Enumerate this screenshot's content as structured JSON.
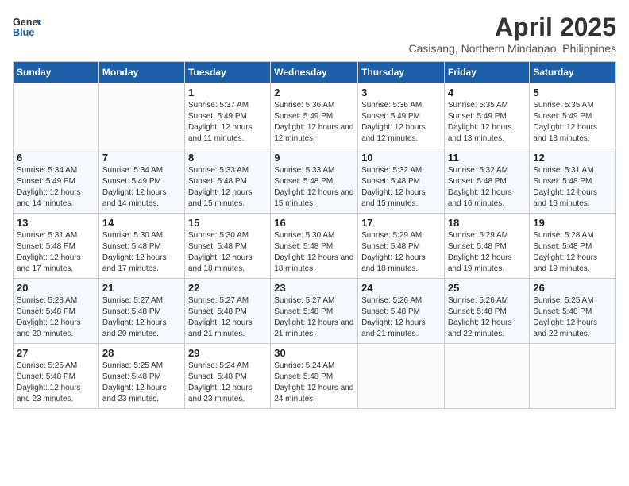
{
  "header": {
    "logo_general": "General",
    "logo_blue": "Blue",
    "month_year": "April 2025",
    "location": "Casisang, Northern Mindanao, Philippines"
  },
  "columns": [
    "Sunday",
    "Monday",
    "Tuesday",
    "Wednesday",
    "Thursday",
    "Friday",
    "Saturday"
  ],
  "weeks": [
    [
      {
        "day": "",
        "sunrise": "",
        "sunset": "",
        "daylight": ""
      },
      {
        "day": "",
        "sunrise": "",
        "sunset": "",
        "daylight": ""
      },
      {
        "day": "1",
        "sunrise": "Sunrise: 5:37 AM",
        "sunset": "Sunset: 5:49 PM",
        "daylight": "Daylight: 12 hours and 11 minutes."
      },
      {
        "day": "2",
        "sunrise": "Sunrise: 5:36 AM",
        "sunset": "Sunset: 5:49 PM",
        "daylight": "Daylight: 12 hours and 12 minutes."
      },
      {
        "day": "3",
        "sunrise": "Sunrise: 5:36 AM",
        "sunset": "Sunset: 5:49 PM",
        "daylight": "Daylight: 12 hours and 12 minutes."
      },
      {
        "day": "4",
        "sunrise": "Sunrise: 5:35 AM",
        "sunset": "Sunset: 5:49 PM",
        "daylight": "Daylight: 12 hours and 13 minutes."
      },
      {
        "day": "5",
        "sunrise": "Sunrise: 5:35 AM",
        "sunset": "Sunset: 5:49 PM",
        "daylight": "Daylight: 12 hours and 13 minutes."
      }
    ],
    [
      {
        "day": "6",
        "sunrise": "Sunrise: 5:34 AM",
        "sunset": "Sunset: 5:49 PM",
        "daylight": "Daylight: 12 hours and 14 minutes."
      },
      {
        "day": "7",
        "sunrise": "Sunrise: 5:34 AM",
        "sunset": "Sunset: 5:49 PM",
        "daylight": "Daylight: 12 hours and 14 minutes."
      },
      {
        "day": "8",
        "sunrise": "Sunrise: 5:33 AM",
        "sunset": "Sunset: 5:48 PM",
        "daylight": "Daylight: 12 hours and 15 minutes."
      },
      {
        "day": "9",
        "sunrise": "Sunrise: 5:33 AM",
        "sunset": "Sunset: 5:48 PM",
        "daylight": "Daylight: 12 hours and 15 minutes."
      },
      {
        "day": "10",
        "sunrise": "Sunrise: 5:32 AM",
        "sunset": "Sunset: 5:48 PM",
        "daylight": "Daylight: 12 hours and 15 minutes."
      },
      {
        "day": "11",
        "sunrise": "Sunrise: 5:32 AM",
        "sunset": "Sunset: 5:48 PM",
        "daylight": "Daylight: 12 hours and 16 minutes."
      },
      {
        "day": "12",
        "sunrise": "Sunrise: 5:31 AM",
        "sunset": "Sunset: 5:48 PM",
        "daylight": "Daylight: 12 hours and 16 minutes."
      }
    ],
    [
      {
        "day": "13",
        "sunrise": "Sunrise: 5:31 AM",
        "sunset": "Sunset: 5:48 PM",
        "daylight": "Daylight: 12 hours and 17 minutes."
      },
      {
        "day": "14",
        "sunrise": "Sunrise: 5:30 AM",
        "sunset": "Sunset: 5:48 PM",
        "daylight": "Daylight: 12 hours and 17 minutes."
      },
      {
        "day": "15",
        "sunrise": "Sunrise: 5:30 AM",
        "sunset": "Sunset: 5:48 PM",
        "daylight": "Daylight: 12 hours and 18 minutes."
      },
      {
        "day": "16",
        "sunrise": "Sunrise: 5:30 AM",
        "sunset": "Sunset: 5:48 PM",
        "daylight": "Daylight: 12 hours and 18 minutes."
      },
      {
        "day": "17",
        "sunrise": "Sunrise: 5:29 AM",
        "sunset": "Sunset: 5:48 PM",
        "daylight": "Daylight: 12 hours and 18 minutes."
      },
      {
        "day": "18",
        "sunrise": "Sunrise: 5:29 AM",
        "sunset": "Sunset: 5:48 PM",
        "daylight": "Daylight: 12 hours and 19 minutes."
      },
      {
        "day": "19",
        "sunrise": "Sunrise: 5:28 AM",
        "sunset": "Sunset: 5:48 PM",
        "daylight": "Daylight: 12 hours and 19 minutes."
      }
    ],
    [
      {
        "day": "20",
        "sunrise": "Sunrise: 5:28 AM",
        "sunset": "Sunset: 5:48 PM",
        "daylight": "Daylight: 12 hours and 20 minutes."
      },
      {
        "day": "21",
        "sunrise": "Sunrise: 5:27 AM",
        "sunset": "Sunset: 5:48 PM",
        "daylight": "Daylight: 12 hours and 20 minutes."
      },
      {
        "day": "22",
        "sunrise": "Sunrise: 5:27 AM",
        "sunset": "Sunset: 5:48 PM",
        "daylight": "Daylight: 12 hours and 21 minutes."
      },
      {
        "day": "23",
        "sunrise": "Sunrise: 5:27 AM",
        "sunset": "Sunset: 5:48 PM",
        "daylight": "Daylight: 12 hours and 21 minutes."
      },
      {
        "day": "24",
        "sunrise": "Sunrise: 5:26 AM",
        "sunset": "Sunset: 5:48 PM",
        "daylight": "Daylight: 12 hours and 21 minutes."
      },
      {
        "day": "25",
        "sunrise": "Sunrise: 5:26 AM",
        "sunset": "Sunset: 5:48 PM",
        "daylight": "Daylight: 12 hours and 22 minutes."
      },
      {
        "day": "26",
        "sunrise": "Sunrise: 5:25 AM",
        "sunset": "Sunset: 5:48 PM",
        "daylight": "Daylight: 12 hours and 22 minutes."
      }
    ],
    [
      {
        "day": "27",
        "sunrise": "Sunrise: 5:25 AM",
        "sunset": "Sunset: 5:48 PM",
        "daylight": "Daylight: 12 hours and 23 minutes."
      },
      {
        "day": "28",
        "sunrise": "Sunrise: 5:25 AM",
        "sunset": "Sunset: 5:48 PM",
        "daylight": "Daylight: 12 hours and 23 minutes."
      },
      {
        "day": "29",
        "sunrise": "Sunrise: 5:24 AM",
        "sunset": "Sunset: 5:48 PM",
        "daylight": "Daylight: 12 hours and 23 minutes."
      },
      {
        "day": "30",
        "sunrise": "Sunrise: 5:24 AM",
        "sunset": "Sunset: 5:48 PM",
        "daylight": "Daylight: 12 hours and 24 minutes."
      },
      {
        "day": "",
        "sunrise": "",
        "sunset": "",
        "daylight": ""
      },
      {
        "day": "",
        "sunrise": "",
        "sunset": "",
        "daylight": ""
      },
      {
        "day": "",
        "sunrise": "",
        "sunset": "",
        "daylight": ""
      }
    ]
  ]
}
